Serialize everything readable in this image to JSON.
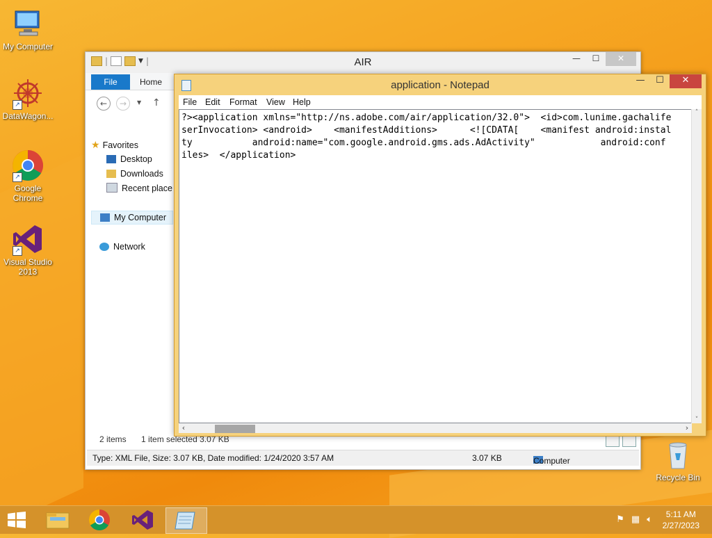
{
  "desktop": {
    "icons": [
      {
        "label": "My Computer"
      },
      {
        "label": "DataWagon..."
      },
      {
        "label": "Google Chrome"
      },
      {
        "label": "Visual Studio 2013"
      },
      {
        "label": "Recycle Bin"
      }
    ]
  },
  "explorer": {
    "title": "AIR",
    "tabs": {
      "file": "File",
      "home": "Home"
    },
    "nav": {
      "favorites": "Favorites",
      "desktop": "Desktop",
      "downloads": "Downloads",
      "recent": "Recent place",
      "my_computer": "My Computer",
      "network": "Network"
    },
    "status": {
      "items": "2 items",
      "selected": "1 item selected  3.07 KB",
      "details": "Type: XML File, Size: 3.07 KB, Date modified: 1/24/2020 3:57 AM",
      "size": "3.07 KB",
      "location": "Computer"
    }
  },
  "notepad": {
    "title": "application - Notepad",
    "menu": {
      "file": "File",
      "edit": "Edit",
      "format": "Format",
      "view": "View",
      "help": "Help"
    },
    "lines": [
      "?><application xmlns=\"http://ns.adobe.com/air/application/32.0\">  <id>com.lunime.gachalife",
      "serInvocation> <android>    <manifestAdditions>      <![CDATA[    <manifest android:instal",
      "ty           android:name=\"com.google.android.gms.ads.AdActivity\"            android:conf",
      "iles>  </application>"
    ]
  },
  "taskbar": {
    "time": "5:11 AM",
    "date": "2/27/2023"
  }
}
